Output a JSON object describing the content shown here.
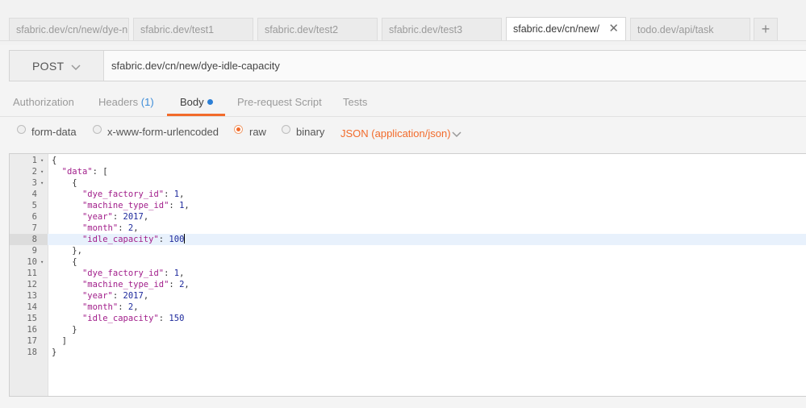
{
  "tabs": [
    {
      "label": "sfabric.dev/cn/new/dye-n",
      "active": false
    },
    {
      "label": "sfabric.dev/test1",
      "active": false
    },
    {
      "label": "sfabric.dev/test2",
      "active": false
    },
    {
      "label": "sfabric.dev/test3",
      "active": false
    },
    {
      "label": "sfabric.dev/cn/new/",
      "active": true,
      "close": "✕"
    },
    {
      "label": "todo.dev/api/task",
      "active": false
    }
  ],
  "tab_add_label": "+",
  "request": {
    "method": "POST",
    "url": "sfabric.dev/cn/new/dye-idle-capacity"
  },
  "req_tabs": {
    "authorization": "Authorization",
    "headers": "Headers",
    "headers_count": "(1)",
    "body": "Body",
    "prerequest": "Pre-request Script",
    "tests": "Tests"
  },
  "body_options": {
    "form_data": "form-data",
    "urlencoded": "x-www-form-urlencoded",
    "raw": "raw",
    "binary": "binary",
    "selected": "raw",
    "content_type": "JSON (application/json)"
  },
  "editor": {
    "lines": [
      {
        "n": "1",
        "fold": true,
        "indent": "",
        "parts": [
          [
            "p",
            "{"
          ]
        ]
      },
      {
        "n": "2",
        "fold": true,
        "indent": "  ",
        "parts": [
          [
            "k",
            "\"data\""
          ],
          [
            "p",
            ": ["
          ]
        ]
      },
      {
        "n": "3",
        "fold": true,
        "indent": "    ",
        "parts": [
          [
            "p",
            "{"
          ]
        ]
      },
      {
        "n": "4",
        "fold": false,
        "indent": "      ",
        "parts": [
          [
            "k",
            "\"dye_factory_id\""
          ],
          [
            "p",
            ": "
          ],
          [
            "n",
            "1"
          ],
          [
            "p",
            ","
          ]
        ]
      },
      {
        "n": "5",
        "fold": false,
        "indent": "      ",
        "parts": [
          [
            "k",
            "\"machine_type_id\""
          ],
          [
            "p",
            ": "
          ],
          [
            "n",
            "1"
          ],
          [
            "p",
            ","
          ]
        ]
      },
      {
        "n": "6",
        "fold": false,
        "indent": "      ",
        "parts": [
          [
            "k",
            "\"year\""
          ],
          [
            "p",
            ": "
          ],
          [
            "n",
            "2017"
          ],
          [
            "p",
            ","
          ]
        ]
      },
      {
        "n": "7",
        "fold": false,
        "indent": "      ",
        "parts": [
          [
            "k",
            "\"month\""
          ],
          [
            "p",
            ": "
          ],
          [
            "n",
            "2"
          ],
          [
            "p",
            ","
          ]
        ]
      },
      {
        "n": "8",
        "fold": false,
        "indent": "      ",
        "parts": [
          [
            "k",
            "\"idle_capacity\""
          ],
          [
            "p",
            ": "
          ],
          [
            "n",
            "100"
          ]
        ],
        "active": true
      },
      {
        "n": "9",
        "fold": false,
        "indent": "    ",
        "parts": [
          [
            "p",
            "},"
          ]
        ]
      },
      {
        "n": "10",
        "fold": true,
        "indent": "    ",
        "parts": [
          [
            "p",
            "{"
          ]
        ]
      },
      {
        "n": "11",
        "fold": false,
        "indent": "      ",
        "parts": [
          [
            "k",
            "\"dye_factory_id\""
          ],
          [
            "p",
            ": "
          ],
          [
            "n",
            "1"
          ],
          [
            "p",
            ","
          ]
        ]
      },
      {
        "n": "12",
        "fold": false,
        "indent": "      ",
        "parts": [
          [
            "k",
            "\"machine_type_id\""
          ],
          [
            "p",
            ": "
          ],
          [
            "n",
            "2"
          ],
          [
            "p",
            ","
          ]
        ]
      },
      {
        "n": "13",
        "fold": false,
        "indent": "      ",
        "parts": [
          [
            "k",
            "\"year\""
          ],
          [
            "p",
            ": "
          ],
          [
            "n",
            "2017"
          ],
          [
            "p",
            ","
          ]
        ]
      },
      {
        "n": "14",
        "fold": false,
        "indent": "      ",
        "parts": [
          [
            "k",
            "\"month\""
          ],
          [
            "p",
            ": "
          ],
          [
            "n",
            "2"
          ],
          [
            "p",
            ","
          ]
        ]
      },
      {
        "n": "15",
        "fold": false,
        "indent": "      ",
        "parts": [
          [
            "k",
            "\"idle_capacity\""
          ],
          [
            "p",
            ": "
          ],
          [
            "n",
            "150"
          ]
        ]
      },
      {
        "n": "16",
        "fold": false,
        "indent": "    ",
        "parts": [
          [
            "p",
            "}"
          ]
        ]
      },
      {
        "n": "17",
        "fold": false,
        "indent": "  ",
        "parts": [
          [
            "p",
            "]"
          ]
        ]
      },
      {
        "n": "18",
        "fold": false,
        "indent": "",
        "parts": [
          [
            "p",
            "}"
          ]
        ]
      }
    ]
  },
  "colors": {
    "accent": "#f26b2b",
    "badge_blue": "#2c7fd6",
    "json_key": "#a11d8a",
    "json_number": "#1e2a9c"
  },
  "icons": {
    "tab_close": "close-icon",
    "method_dropdown": "chevron-down-icon",
    "content_type_dropdown": "chevron-down-icon",
    "new_tab": "plus-icon"
  }
}
